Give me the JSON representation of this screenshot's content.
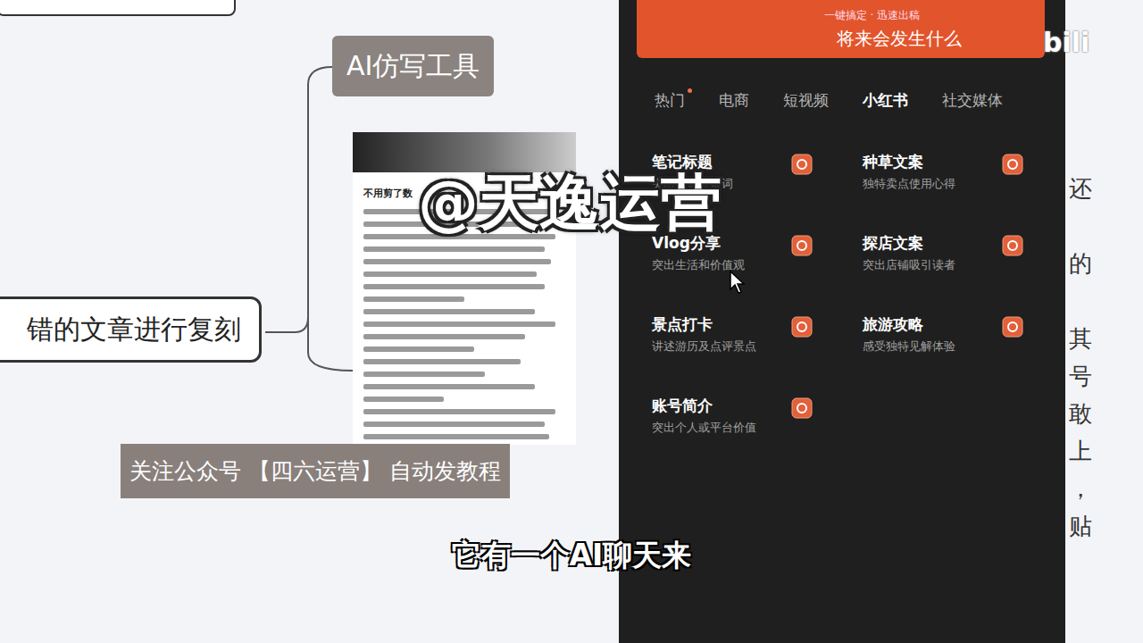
{
  "mindmap": {
    "tool_node": "AI仿写工具",
    "source_node": "错的文章进行复刻",
    "article": {
      "title": "不用剪了数",
      "text_lines": [
        0.92,
        0.88,
        0.95,
        0.9,
        0.93,
        0.86,
        0.9,
        0.5,
        0.85,
        0.95,
        0.8,
        0.55,
        0.78,
        0.6,
        0.85,
        0.4,
        0.95,
        0.9,
        0.92
      ]
    }
  },
  "promo_banner": "关注公众号 【四六运营】 自动发教程",
  "panel": {
    "banner": {
      "slogan": "一键搞定 · 迅速出稿",
      "headline": "将来会发生什么"
    },
    "tabs": [
      {
        "label": "热门",
        "selected": false,
        "hot": true
      },
      {
        "label": "电商",
        "selected": false,
        "hot": false
      },
      {
        "label": "短视频",
        "selected": false,
        "hot": false
      },
      {
        "label": "小红书",
        "selected": true,
        "hot": false
      },
      {
        "label": "社交媒体",
        "selected": false,
        "hot": false
      }
    ],
    "items": [
      {
        "title": "笔记标题",
        "subtitle": "突出笔记关键词"
      },
      {
        "title": "种草文案",
        "subtitle": "独特卖点使用心得"
      },
      {
        "title": "Vlog分享",
        "subtitle": "突出生活和价值观"
      },
      {
        "title": "探店文案",
        "subtitle": "突出店铺吸引读者"
      },
      {
        "title": "景点打卡",
        "subtitle": "讲述游历及点评景点"
      },
      {
        "title": "旅游攻略",
        "subtitle": "感受独特见解体验"
      },
      {
        "title": "账号简介",
        "subtitle": "突出个人或平台价值"
      }
    ]
  },
  "side_text": [
    "还",
    "",
    "的",
    "",
    "其",
    "号",
    "敢",
    "上",
    "，",
    "贴",
    ""
  ],
  "logo": "bili",
  "watermark": "@天逸运营",
  "subtitle": "它有一个AI聊天来"
}
